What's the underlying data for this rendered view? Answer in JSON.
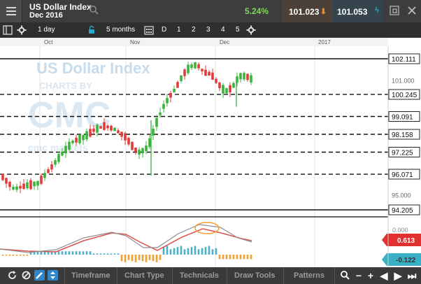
{
  "header": {
    "instrument": "US Dollar Index",
    "contract": "Dec 2016",
    "change_pct": "5.24%",
    "sell_price": "101.023",
    "buy_price": "101.053"
  },
  "toolbar": {
    "timeframe": "1 day",
    "range": "5 months",
    "draw_d": "D",
    "buttons": [
      "1",
      "2",
      "3",
      "4",
      "5"
    ]
  },
  "chart": {
    "x_labels": [
      "Oct",
      "Nov",
      "Dec",
      "2017"
    ],
    "watermark": {
      "line1": "US Dollar Index",
      "line2": "CHARTS BY",
      "line3": "CMC",
      "line4": "cmc markets"
    },
    "price_labels": [
      "102.111",
      "101.000",
      "100.245",
      "99.091",
      "98.158",
      "97.225",
      "96.071",
      "95.000",
      "94.205"
    ],
    "indicator_labels": {
      "top": "0.000",
      "macd": "0.613",
      "hist": "-0.122"
    }
  },
  "chart_data": {
    "type": "candlestick",
    "title": "US Dollar Index",
    "x": [
      "Oct",
      "Nov",
      "Dec",
      "2017"
    ],
    "ylim": [
      94.205,
      102.111
    ],
    "horizontal_lines": [
      102.111,
      100.245,
      99.091,
      98.158,
      97.225,
      96.071,
      94.205
    ],
    "last_price": 101.0,
    "macd": 0.613,
    "macd_histogram": -0.122,
    "colors": {
      "up": "#3cb43c",
      "down": "#e03c3c",
      "macd_line": "#e05050",
      "signal_line": "#9a9a9a",
      "hist_pos": "#4ab0c8",
      "hist_neg": "#f0a030",
      "highlight": "#f0a030"
    }
  },
  "bottom": {
    "menus": [
      "Timeframe",
      "Chart Type",
      "Technicals",
      "Draw Tools",
      "Patterns"
    ]
  }
}
